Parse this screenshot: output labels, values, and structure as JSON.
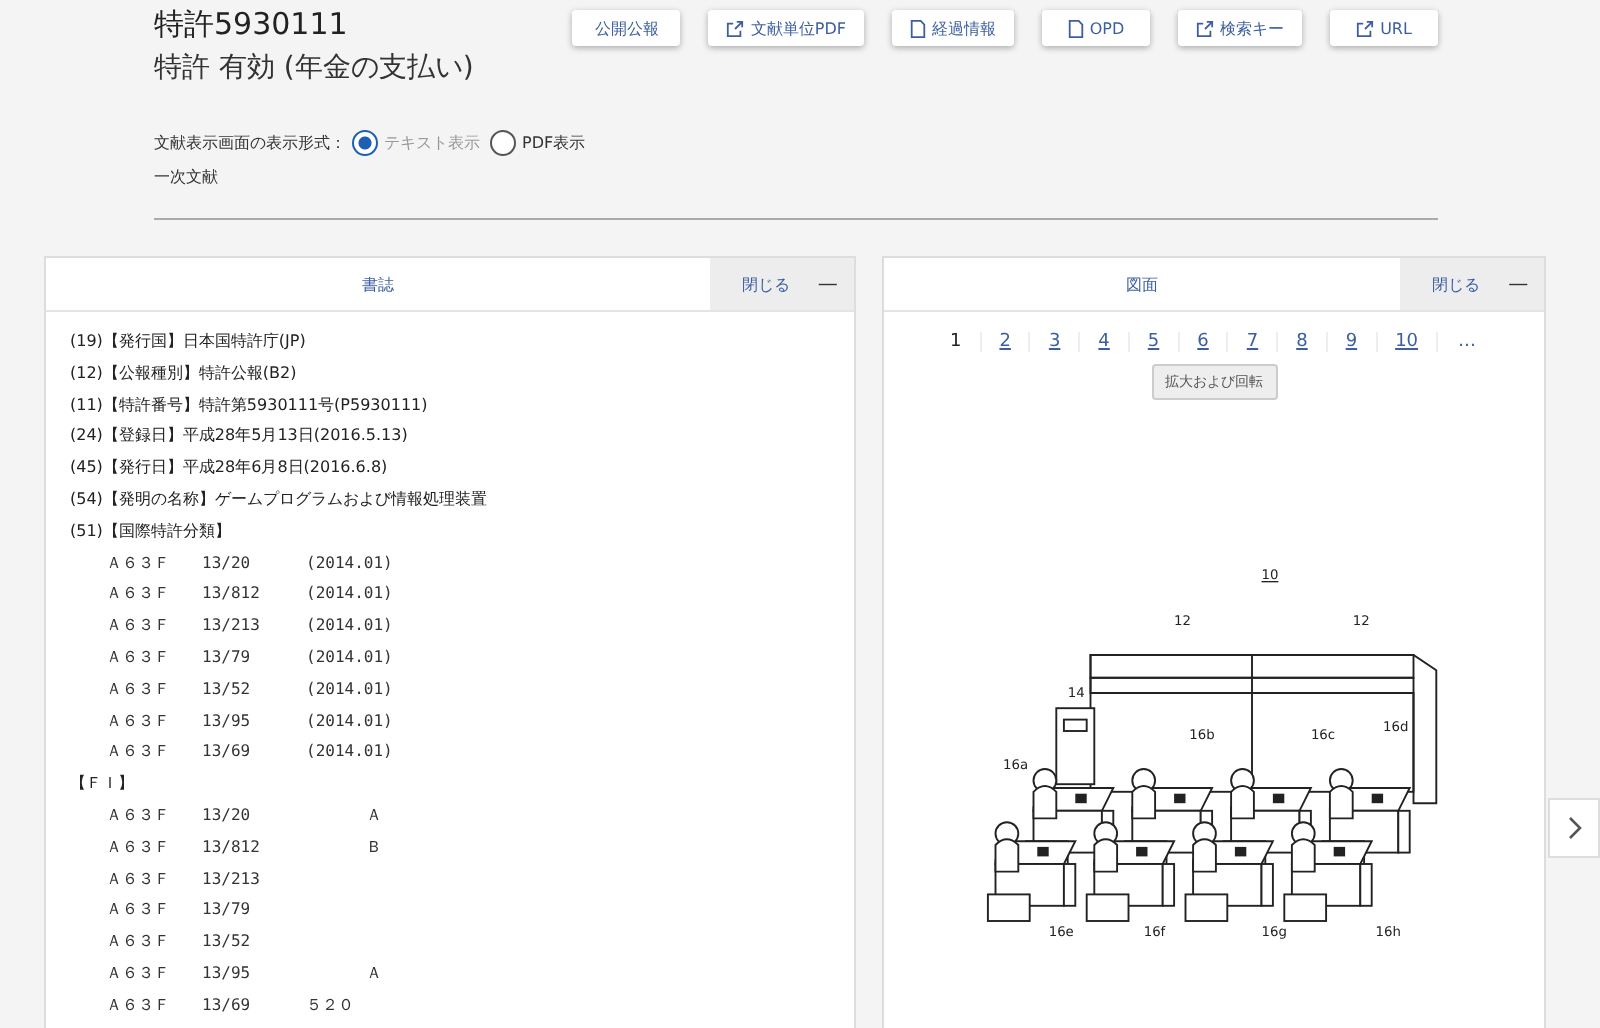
{
  "header": {
    "title": "特許5930111",
    "status": "特許 有効 (年金の支払い)"
  },
  "actions": [
    {
      "label": "公開公報",
      "kind": "none"
    },
    {
      "label": "文献単位PDF",
      "kind": "external"
    },
    {
      "label": "経過情報",
      "kind": "document"
    },
    {
      "label": "OPD",
      "kind": "document"
    },
    {
      "label": "検索キー",
      "kind": "external"
    },
    {
      "label": "URL",
      "kind": "external"
    }
  ],
  "display_format": {
    "label": "文献表示画面の表示形式：",
    "options": [
      {
        "label": "テキスト表示",
        "selected": true
      },
      {
        "label": "PDF表示",
        "selected": false
      }
    ]
  },
  "document_type": "一次文献",
  "biblio_panel": {
    "title": "書誌",
    "close": "閉じる",
    "collapse": "—",
    "lines": [
      "(19)【発行国】日本国特許庁(JP)",
      "(12)【公報種別】特許公報(B2)",
      "(11)【特許番号】特許第5930111号(P5930111)",
      "(24)【登録日】平成28年5月13日(2016.5.13)",
      "(45)【発行日】平成28年6月8日(2016.6.8)",
      "(54)【発明の名称】ゲームプログラムおよび情報処理装置",
      "(51)【国際特許分類】"
    ],
    "ipc": [
      {
        "code": "Ａ６３Ｆ",
        "group": "13/20",
        "version": "(2014.01)"
      },
      {
        "code": "Ａ６３Ｆ",
        "group": "13/812",
        "version": "(2014.01)"
      },
      {
        "code": "Ａ６３Ｆ",
        "group": "13/213",
        "version": "(2014.01)"
      },
      {
        "code": "Ａ６３Ｆ",
        "group": "13/79",
        "version": "(2014.01)"
      },
      {
        "code": "Ａ６３Ｆ",
        "group": "13/52",
        "version": "(2014.01)"
      },
      {
        "code": "Ａ６３Ｆ",
        "group": "13/95",
        "version": "(2014.01)"
      },
      {
        "code": "Ａ６３Ｆ",
        "group": "13/69",
        "version": "(2014.01)"
      }
    ],
    "fi_heading": "【ＦＩ】",
    "fi": [
      {
        "code": "Ａ６３Ｆ",
        "group": "13/20",
        "symbol": "Ａ"
      },
      {
        "code": "Ａ６３Ｆ",
        "group": "13/812",
        "symbol": "Ｂ"
      },
      {
        "code": "Ａ６３Ｆ",
        "group": "13/213"
      },
      {
        "code": "Ａ６３Ｆ",
        "group": "13/79"
      },
      {
        "code": "Ａ６３Ｆ",
        "group": "13/52"
      },
      {
        "code": "Ａ６３Ｆ",
        "group": "13/95",
        "symbol": "Ａ"
      },
      {
        "code": "Ａ６３Ｆ",
        "group": "13/69",
        "extra": "５２０"
      }
    ]
  },
  "drawing_panel": {
    "title": "図面",
    "close": "閉じる",
    "collapse": "—",
    "pages": [
      {
        "label": "1",
        "selected": true
      },
      {
        "label": "2",
        "selected": false
      },
      {
        "label": "3",
        "selected": false
      },
      {
        "label": "4",
        "selected": false
      },
      {
        "label": "5",
        "selected": false
      },
      {
        "label": "6",
        "selected": false
      },
      {
        "label": "7",
        "selected": false
      },
      {
        "label": "8",
        "selected": false
      },
      {
        "label": "9",
        "selected": false
      },
      {
        "label": "10",
        "selected": false
      }
    ],
    "more": "…",
    "zoom_button": "拡大および回転",
    "figure_labels": [
      "10",
      "12",
      "12",
      "14",
      "16a",
      "16b",
      "16c",
      "16d",
      "16e",
      "16f",
      "16g",
      "16h"
    ]
  }
}
